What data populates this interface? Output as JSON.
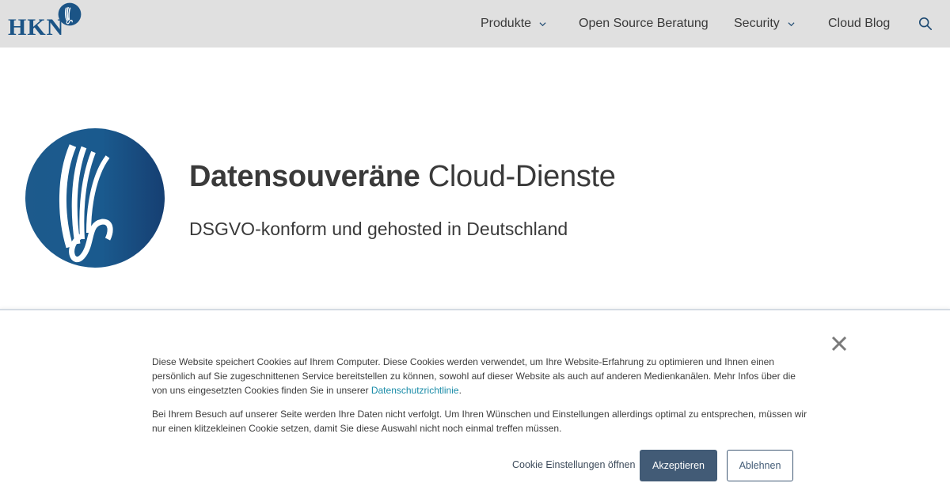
{
  "header": {
    "logo_text": "HKN",
    "nav": [
      {
        "label": "Produkte",
        "has_dropdown": true
      },
      {
        "label": "Open Source Beratung",
        "has_dropdown": false
      },
      {
        "label": "Security",
        "has_dropdown": true
      },
      {
        "label": "Cloud Blog",
        "has_dropdown": false
      }
    ],
    "search_icon": "search-icon"
  },
  "hero": {
    "title_bold": "Datensouveräne",
    "title_regular": "Cloud-Dienste",
    "subtitle": "DSGVO-konform und gehosted in Deutschland"
  },
  "cookie_banner": {
    "paragraph1_text": "Diese Website speichert Cookies auf Ihrem Computer. Diese Cookies werden verwendet, um Ihre Website-Erfahrung zu optimieren und Ihnen einen persönlich auf Sie zugeschnittenen Service bereitstellen zu können, sowohl auf dieser Website als auch auf anderen Medienkanälen. Mehr Infos über die von uns eingesetzten Cookies finden Sie in unserer ",
    "privacy_link": "Datenschutzrichtlinie",
    "paragraph1_end": ".",
    "paragraph2": "Bei Ihrem Besuch auf unserer Seite werden Ihre Daten nicht verfolgt. Um Ihren Wünschen und Einstellungen allerdings optimal zu entsprechen, müssen wir nur einen klitzekleinen Cookie setzen, damit Sie diese Auswahl nicht noch einmal treffen müssen.",
    "settings_label": "Cookie Einstellungen öffnen",
    "accept_label": "Akzeptieren",
    "decline_label": "Ablehnen",
    "close_icon": "close-icon"
  },
  "colors": {
    "brand_blue": "#1b5486",
    "nav_text": "#1e4a72",
    "header_bg": "#e0e0e0",
    "accept_bg": "#425b76",
    "link": "#1a8ca8"
  }
}
